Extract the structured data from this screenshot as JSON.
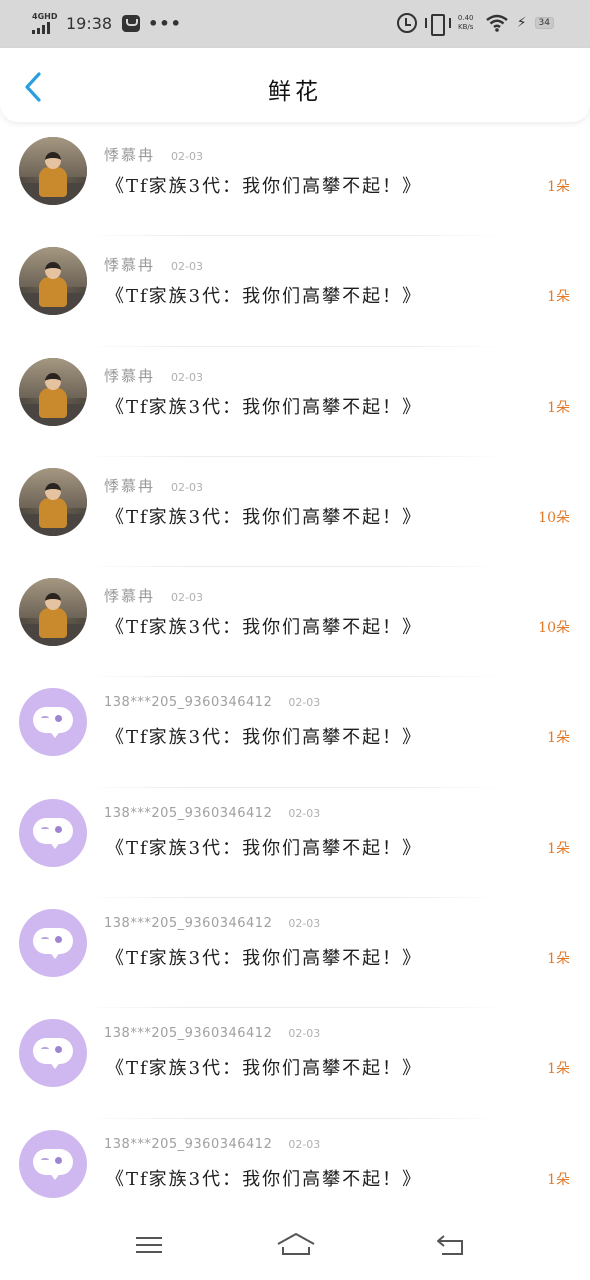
{
  "status_bar": {
    "network_label": "4GHD",
    "time": "19:38",
    "more": "•••",
    "speed_value": "0.40",
    "speed_unit": "KB/s",
    "battery": "34"
  },
  "header": {
    "title": "鲜花"
  },
  "items": [
    {
      "avatar": "photo",
      "name": "悸慕冉",
      "date": "02-03",
      "book": "《Tf家族3代：我你们高攀不起！》",
      "amount": "1朵"
    },
    {
      "avatar": "photo",
      "name": "悸慕冉",
      "date": "02-03",
      "book": "《Tf家族3代：我你们高攀不起！》",
      "amount": "1朵"
    },
    {
      "avatar": "photo",
      "name": "悸慕冉",
      "date": "02-03",
      "book": "《Tf家族3代：我你们高攀不起！》",
      "amount": "1朵"
    },
    {
      "avatar": "photo",
      "name": "悸慕冉",
      "date": "02-03",
      "book": "《Tf家族3代：我你们高攀不起！》",
      "amount": "10朵"
    },
    {
      "avatar": "photo",
      "name": "悸慕冉",
      "date": "02-03",
      "book": "《Tf家族3代：我你们高攀不起！》",
      "amount": "10朵"
    },
    {
      "avatar": "bot",
      "name": "138***205_9360346412",
      "date": "02-03",
      "book": "《Tf家族3代：我你们高攀不起！》",
      "amount": "1朵"
    },
    {
      "avatar": "bot",
      "name": "138***205_9360346412",
      "date": "02-03",
      "book": "《Tf家族3代：我你们高攀不起！》",
      "amount": "1朵"
    },
    {
      "avatar": "bot",
      "name": "138***205_9360346412",
      "date": "02-03",
      "book": "《Tf家族3代：我你们高攀不起！》",
      "amount": "1朵"
    },
    {
      "avatar": "bot",
      "name": "138***205_9360346412",
      "date": "02-03",
      "book": "《Tf家族3代：我你们高攀不起！》",
      "amount": "1朵"
    },
    {
      "avatar": "bot",
      "name": "138***205_9360346412",
      "date": "02-03",
      "book": "《Tf家族3代：我你们高攀不起！》",
      "amount": "1朵"
    }
  ],
  "colors": {
    "accent_back": "#2a9fe0",
    "amount": "#e07a2a",
    "bot_avatar": "#cfb8ef"
  },
  "icons": {
    "back": "chevron-left-icon",
    "nav_menu": "menu-icon",
    "nav_home": "home-icon",
    "nav_back": "return-icon"
  }
}
